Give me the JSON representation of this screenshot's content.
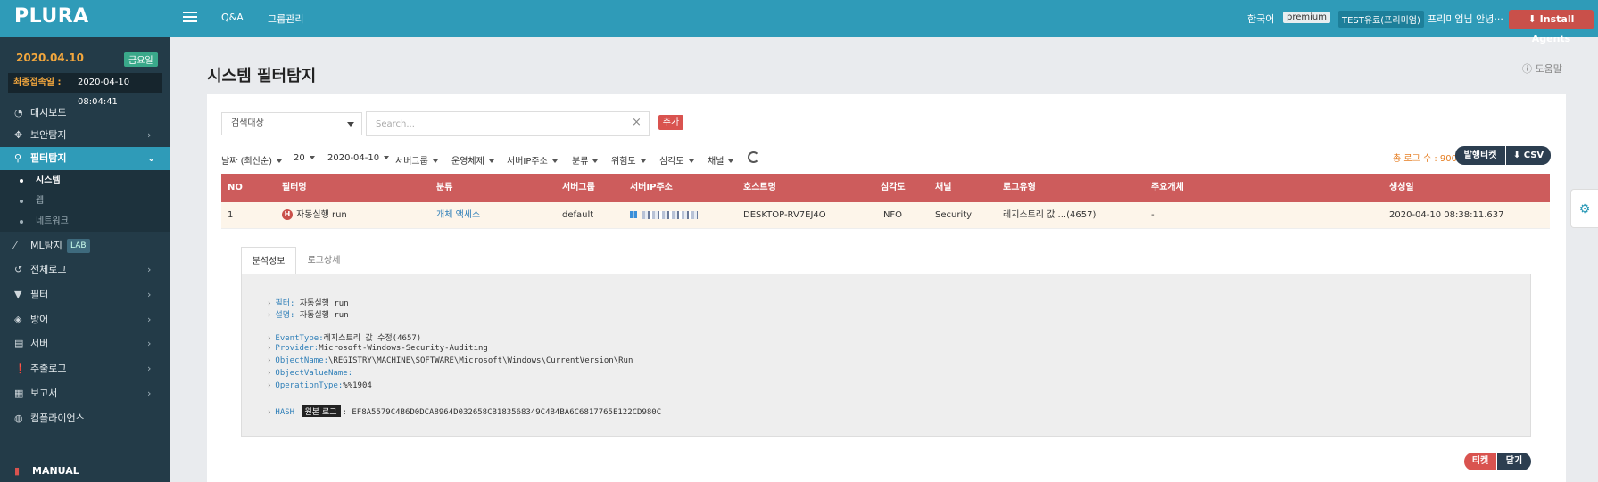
{
  "header": {
    "logo": "PLURA",
    "nav": [
      "Q&A",
      "그룹관리"
    ],
    "language": "한국어",
    "plan_badge": "premium",
    "account_badge": "TEST유료(프리미엄)",
    "user": "프리미엄님 안녕···",
    "install_button": "Install Agents",
    "brand_color": "#2f9bb8"
  },
  "sidebar": {
    "date": "2020.04.10",
    "weekday": "금요일",
    "last_login_label": "최종접속일 :",
    "last_login_value": "2020-04-10 08:04:41",
    "items": [
      {
        "label": "대시보드",
        "icon": "dashboard-icon",
        "has_chevron": false
      },
      {
        "label": "보안탐지",
        "icon": "crosshair-icon",
        "has_chevron": true
      },
      {
        "label": "필터탐지",
        "icon": "search-icon",
        "has_chevron": true,
        "active": true
      },
      {
        "label": "ML탐지",
        "icon": "wand-icon",
        "badge": "LAB",
        "has_chevron": false
      },
      {
        "label": "전체로그",
        "icon": "history-icon",
        "has_chevron": true
      },
      {
        "label": "필터",
        "icon": "filter-icon",
        "has_chevron": true
      },
      {
        "label": "방어",
        "icon": "shield-icon",
        "has_chevron": true
      },
      {
        "label": "서버",
        "icon": "server-icon",
        "has_chevron": true
      },
      {
        "label": "추출로그",
        "icon": "exclamation-icon",
        "has_chevron": true
      },
      {
        "label": "보고서",
        "icon": "report-icon",
        "has_chevron": true
      },
      {
        "label": "컴플라이언스",
        "icon": "globe-icon",
        "has_chevron": false
      }
    ],
    "submenu": [
      {
        "label": "시스템",
        "active": true
      },
      {
        "label": "웹",
        "active": false
      },
      {
        "label": "네트워크",
        "active": false
      }
    ],
    "manual": "MANUAL"
  },
  "page": {
    "title": "시스템 필터탐지",
    "help": "도움말"
  },
  "search": {
    "target_select": "검색대상",
    "placeholder": "Search...",
    "add_button": "추가"
  },
  "filters": [
    "날짜 (최신순)",
    "20",
    "2020-04-10",
    "서버그룹",
    "운영체제",
    "서버IP주소",
    "분류",
    "위험도",
    "심각도",
    "채널"
  ],
  "summary": {
    "total_label": "총 로그 수 : 900",
    "ticket_button": "발행티켓",
    "csv_button": "CSV"
  },
  "table": {
    "columns": [
      "NO",
      "필터명",
      "분류",
      "서버그룹",
      "서버IP주소",
      "호스트명",
      "심각도",
      "채널",
      "로그유형",
      "주요개체",
      "생성일"
    ],
    "rows": [
      {
        "no": "1",
        "filter_name": "자동실행 run",
        "category": "개체 액세스",
        "server_group": "default",
        "server_ip": "",
        "host": "DESKTOP-RV7EJ4O",
        "severity": "INFO",
        "channel": "Security",
        "log_type": "레지스트리 값 ...(4657)",
        "main_object": "-",
        "created": "2020-04-10 08:38:11.637"
      }
    ]
  },
  "detail": {
    "tabs": [
      "분석정보",
      "로그상세"
    ],
    "filter_key": "필터:",
    "filter_value": "자동실행 run",
    "desc_key": "설명:",
    "desc_value": "자동실행 run",
    "fields": [
      {
        "key": "EventType:",
        "value": "레지스트리 값 수정(4657)"
      },
      {
        "key": "Provider:",
        "value": "Microsoft-Windows-Security-Auditing"
      },
      {
        "key": "ObjectName:",
        "value": "\\REGISTRY\\MACHINE\\SOFTWARE\\Microsoft\\Windows\\CurrentVersion\\Run"
      },
      {
        "key": "ObjectValueName:",
        "value": ""
      },
      {
        "key": "OperationType:",
        "value": "%%1904"
      }
    ],
    "hash_key": "HASH",
    "orig_log_badge": "원본 로그",
    "hash_value": "EF8A5579C4B6D0DCA8964D032658CB183568349C4B4BA6C6817765E122CD980C",
    "ticket_button": "티켓",
    "close_button": "닫기"
  }
}
